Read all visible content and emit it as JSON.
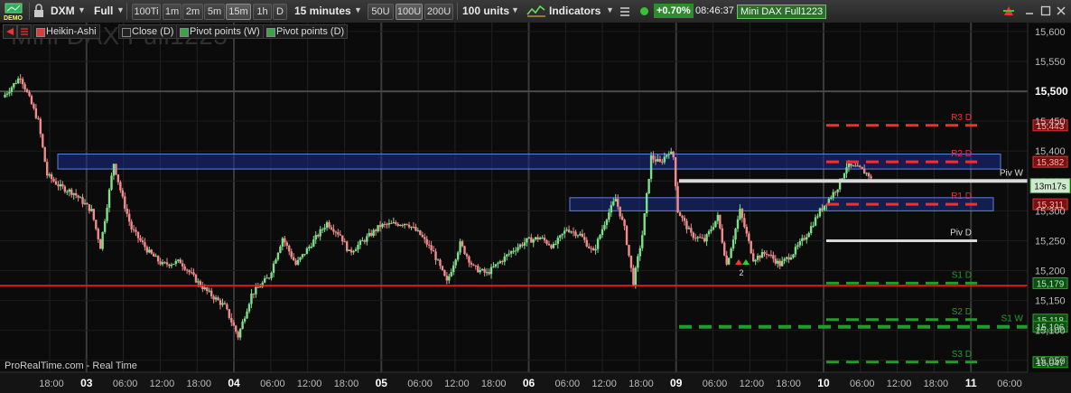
{
  "toolbar": {
    "demo_label": "DEMO",
    "symbol": "DXM",
    "view_mode": "Full",
    "tick_buttons": [
      "100Ti",
      "1m",
      "2m",
      "5m",
      "15m",
      "1h",
      "D"
    ],
    "selected_tick": "15m",
    "timeframe": "15 minutes",
    "unit_buttons": [
      "50U",
      "100U",
      "200U"
    ],
    "selected_unit": "100U",
    "units": "100 units",
    "indicators_label": "Indicators",
    "change": "+0.70%",
    "time": "08:46:37",
    "instrument_badge": "Mini DAX Full1223",
    "icons": [
      "demo-icon",
      "lock-icon",
      "indicators-icon",
      "status-dot-icon",
      "refresh-icon",
      "minimize-icon",
      "maximize-icon",
      "close-icon"
    ]
  },
  "legend": [
    {
      "label": "Heikin-Ashi",
      "color": "#e23a3a"
    },
    {
      "label": "Close (D)",
      "color": "#222222"
    },
    {
      "label": "Pivot points (W)",
      "color": "#3fa24a"
    },
    {
      "label": "Pivot points (D)",
      "color": "#3fa24a"
    }
  ],
  "watermark": "Mini DAX Full1223",
  "footer": "ProRealTime.com - Real Time",
  "colors": {
    "up": "#7ee08a",
    "down": "#f28b8b",
    "resistance": "#ff2a2a",
    "support": "#1f9e2a",
    "pivot": "#d9d9d9",
    "zone_fill": "#1b2f8a",
    "zone_border": "#5d80e6",
    "support_line": "#ff2020",
    "positive": "#2e8b2e"
  },
  "chart_data": {
    "type": "candlestick",
    "ylim": [
      15030,
      15615
    ],
    "y_ticks": [
      "15,600",
      "15,550",
      "15,500",
      "15,450",
      "15,400",
      "15,350",
      "15,300",
      "15,250",
      "15,200",
      "15,150",
      "15,100",
      "15,050"
    ],
    "major_y_tick": "15,500",
    "x_ticks": [
      {
        "label": "18:00",
        "bold": false
      },
      {
        "label": "03",
        "bold": true
      },
      {
        "label": "06:00",
        "bold": false
      },
      {
        "label": "12:00",
        "bold": false
      },
      {
        "label": "18:00",
        "bold": false
      },
      {
        "label": "04",
        "bold": true
      },
      {
        "label": "06:00",
        "bold": false
      },
      {
        "label": "12:00",
        "bold": false
      },
      {
        "label": "18:00",
        "bold": false
      },
      {
        "label": "05",
        "bold": true
      },
      {
        "label": "06:00",
        "bold": false
      },
      {
        "label": "12:00",
        "bold": false
      },
      {
        "label": "18:00",
        "bold": false
      },
      {
        "label": "06",
        "bold": true
      },
      {
        "label": "06:00",
        "bold": false
      },
      {
        "label": "12:00",
        "bold": false
      },
      {
        "label": "18:00",
        "bold": false
      },
      {
        "label": "09",
        "bold": true
      },
      {
        "label": "06:00",
        "bold": false
      },
      {
        "label": "12:00",
        "bold": false
      },
      {
        "label": "18:00",
        "bold": false
      },
      {
        "label": "10",
        "bold": true
      },
      {
        "label": "06:00",
        "bold": false
      },
      {
        "label": "12:00",
        "bold": false
      },
      {
        "label": "18:00",
        "bold": false
      },
      {
        "label": "11",
        "bold": true
      },
      {
        "label": "06:00",
        "bold": false
      }
    ],
    "price_path": [
      [
        0,
        15490
      ],
      [
        4,
        15525
      ],
      [
        8,
        15450
      ],
      [
        10,
        15360
      ],
      [
        13,
        15340
      ],
      [
        16,
        15330
      ],
      [
        20,
        15300
      ],
      [
        22,
        15240
      ],
      [
        25,
        15380
      ],
      [
        27,
        15320
      ],
      [
        29,
        15270
      ],
      [
        33,
        15230
      ],
      [
        36,
        15210
      ],
      [
        40,
        15215
      ],
      [
        44,
        15180
      ],
      [
        46,
        15165
      ],
      [
        50,
        15140
      ],
      [
        53,
        15090
      ],
      [
        56,
        15160
      ],
      [
        60,
        15190
      ],
      [
        63,
        15255
      ],
      [
        66,
        15210
      ],
      [
        70,
        15250
      ],
      [
        73,
        15280
      ],
      [
        76,
        15260
      ],
      [
        78,
        15230
      ],
      [
        82,
        15255
      ],
      [
        85,
        15275
      ],
      [
        88,
        15278
      ],
      [
        91,
        15280
      ],
      [
        94,
        15260
      ],
      [
        97,
        15230
      ],
      [
        100,
        15180
      ],
      [
        103,
        15245
      ],
      [
        106,
        15205
      ],
      [
        109,
        15195
      ],
      [
        112,
        15215
      ],
      [
        115,
        15235
      ],
      [
        118,
        15250
      ],
      [
        121,
        15255
      ],
      [
        124,
        15240
      ],
      [
        127,
        15270
      ],
      [
        130,
        15260
      ],
      [
        133,
        15230
      ],
      [
        136,
        15290
      ],
      [
        138,
        15320
      ],
      [
        140,
        15270
      ],
      [
        142,
        15180
      ],
      [
        144,
        15260
      ],
      [
        146,
        15390
      ],
      [
        148,
        15380
      ],
      [
        150,
        15400
      ],
      [
        151,
        15390
      ],
      [
        152,
        15300
      ],
      [
        155,
        15260
      ],
      [
        158,
        15250
      ],
      [
        161,
        15290
      ],
      [
        163,
        15210
      ],
      [
        166,
        15300
      ],
      [
        169,
        15220
      ],
      [
        172,
        15230
      ],
      [
        175,
        15210
      ],
      [
        178,
        15230
      ],
      [
        181,
        15260
      ],
      [
        184,
        15300
      ],
      [
        186,
        15320
      ],
      [
        188,
        15340
      ],
      [
        190,
        15375
      ],
      [
        193,
        15370
      ],
      [
        195,
        15360
      ],
      [
        196,
        15345
      ]
    ],
    "zones": [
      {
        "from": 15370,
        "to": 15395
      },
      {
        "from": 15300,
        "to": 15322
      }
    ],
    "support_line": 15175,
    "pivot_levels": [
      {
        "label": "R3 D",
        "value": 15443,
        "tag": "15,443",
        "kind": "resistance"
      },
      {
        "label": "R2 D",
        "value": 15382,
        "tag": "15,382",
        "kind": "resistance"
      },
      {
        "label": "Piv W",
        "value": 15350,
        "tag": "",
        "kind": "pivot"
      },
      {
        "label": "R1 D",
        "value": 15311,
        "tag": "15,311",
        "kind": "resistance"
      },
      {
        "label": "Piv D",
        "value": 15250,
        "tag": "",
        "kind": "pivot"
      },
      {
        "label": "S1 D",
        "value": 15179,
        "tag": "15,179",
        "kind": "support"
      },
      {
        "label": "S2 D",
        "value": 15118,
        "tag": "15,118",
        "kind": "support"
      },
      {
        "label": "S1 W",
        "value": 15106,
        "tag": "15,106",
        "kind": "support"
      },
      {
        "label": "S3 D",
        "value": 15047,
        "tag": "15,047",
        "kind": "support"
      }
    ],
    "last_price_tag": "13m17s",
    "signal_label": "2"
  }
}
